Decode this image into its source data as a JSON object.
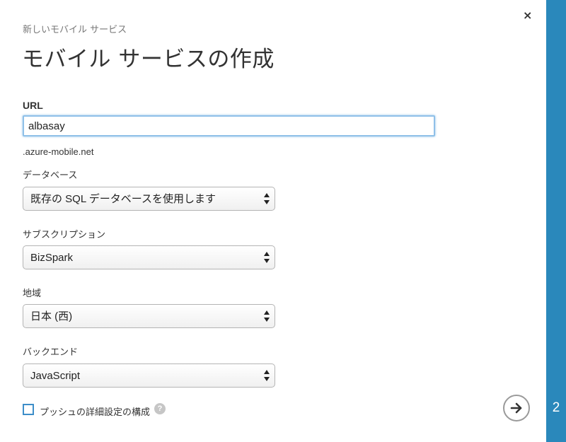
{
  "header": {
    "subtitle": "新しいモバイル サービス",
    "title": "モバイル サービスの作成",
    "close_glyph": "×"
  },
  "form": {
    "url": {
      "label": "URL",
      "value": "albasay",
      "suffix": ".azure-mobile.net"
    },
    "database": {
      "label": "データベース",
      "selected": "既存の SQL データベースを使用します"
    },
    "subscription": {
      "label": "サブスクリプション",
      "selected": "BizSpark"
    },
    "region": {
      "label": "地域",
      "selected": "日本 (西)"
    },
    "backend": {
      "label": "バックエンド",
      "selected": "JavaScript"
    },
    "push": {
      "label": "プッシュの詳細設定の構成",
      "checked": false,
      "help_glyph": "?"
    }
  },
  "wizard": {
    "step": "2",
    "next_icon": "arrow-right-circle-icon"
  },
  "colors": {
    "accent": "#2a88bb",
    "focus": "#8fc0e8",
    "checkbox": "#3d8ec9"
  }
}
